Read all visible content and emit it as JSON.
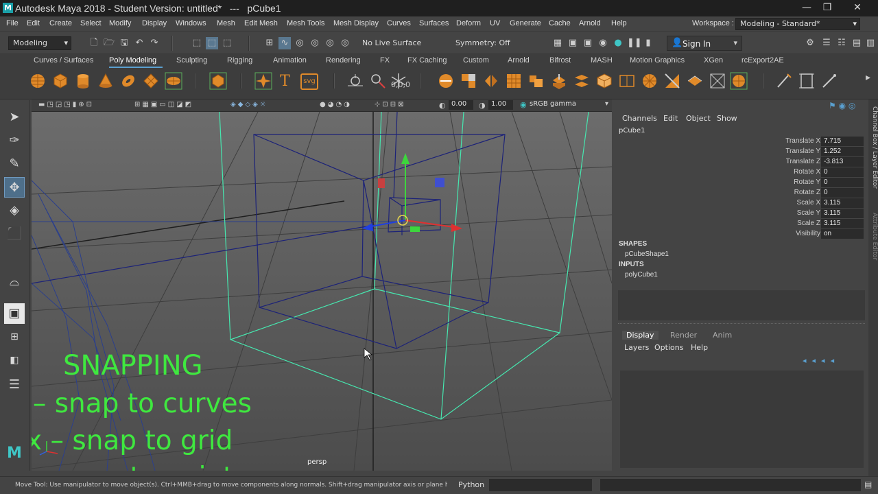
{
  "window": {
    "title": "Autodesk Maya 2018 - Student Version: untitled*   ---   pCube1",
    "minimize": "—",
    "maximize": "❐",
    "close": "✕"
  },
  "menu": {
    "items": [
      "File",
      "Edit",
      "Create",
      "Select",
      "Modify",
      "Display",
      "Windows",
      "Mesh",
      "Edit Mesh",
      "Mesh Tools",
      "Mesh Display",
      "Curves",
      "Surfaces",
      "Deform",
      "UV",
      "Generate",
      "Cache",
      "Arnold",
      "Help"
    ],
    "workspace_label": "Workspace :",
    "workspace_value": "Modeling - Standard*"
  },
  "statusline": {
    "mode": "Modeling",
    "live_surface": "No Live Surface",
    "symmetry": "Symmetry: Off",
    "sign_in": "Sign In"
  },
  "shelf": {
    "tabs": [
      "Curves / Surfaces",
      "Poly Modeling",
      "Sculpting",
      "Rigging",
      "Animation",
      "Rendering",
      "FX",
      "FX Caching",
      "Custom",
      "Arnold",
      "Bifrost",
      "MASH",
      "Motion Graphics",
      "XGen",
      "rcExport2AE"
    ],
    "active_tab": "Poly Modeling",
    "snap_readout": "0,0,0"
  },
  "viewport": {
    "exposure": "0.00",
    "gamma": "1.00",
    "color_space": "sRGB gamma",
    "camera_label": "persp"
  },
  "overlay": {
    "heading": "SNAPPING",
    "line1": "c – snap to curves",
    "line2": "x – snap to grid",
    "line3": "v – snap to points"
  },
  "channelbox": {
    "menus": [
      "Channels",
      "Edit",
      "Object",
      "Show"
    ],
    "object_name": "pCube1",
    "attributes": [
      {
        "label": "Translate X",
        "value": "7.715"
      },
      {
        "label": "Translate Y",
        "value": "1.252"
      },
      {
        "label": "Translate Z",
        "value": "-3.813"
      },
      {
        "label": "Rotate X",
        "value": "0"
      },
      {
        "label": "Rotate Y",
        "value": "0"
      },
      {
        "label": "Rotate Z",
        "value": "0"
      },
      {
        "label": "Scale X",
        "value": "3.115"
      },
      {
        "label": "Scale Y",
        "value": "3.115"
      },
      {
        "label": "Scale Z",
        "value": "3.115"
      },
      {
        "label": "Visibility",
        "value": "on"
      }
    ],
    "shapes_heading": "SHAPES",
    "shape_node": "pCubeShape1",
    "inputs_heading": "INPUTS",
    "input_node": "polyCube1",
    "side_tab_label": "Channel Box / Layer Editor",
    "side_tab_label2": "Attribute Editor"
  },
  "layer_editor": {
    "tabs": [
      "Display",
      "Render",
      "Anim"
    ],
    "active_tab": "Display",
    "menus": [
      "Layers",
      "Options",
      "Help"
    ]
  },
  "helpline": {
    "text": "Move Tool: Use manipulator to move object(s). Ctrl+MMB+drag to move components along normals. Shift+drag manipulator axis or plane handles to e",
    "python_label": "Python"
  }
}
